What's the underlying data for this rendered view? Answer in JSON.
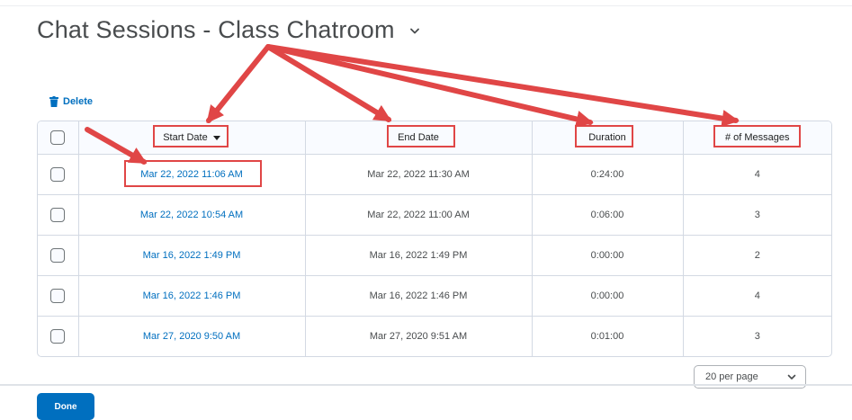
{
  "page": {
    "title": "Chat Sessions - Class Chatroom"
  },
  "toolbar": {
    "delete_label": "Delete"
  },
  "table": {
    "columns": {
      "start_date": "Start Date",
      "end_date": "End Date",
      "duration": "Duration",
      "messages": "# of Messages"
    },
    "sort": {
      "column": "start_date",
      "direction": "descending"
    },
    "rows": [
      {
        "start": "Mar 22, 2022 11:06 AM",
        "end": "Mar 22, 2022 11:30 AM",
        "duration": "0:24:00",
        "messages": "4"
      },
      {
        "start": "Mar 22, 2022 10:54 AM",
        "end": "Mar 22, 2022 11:00 AM",
        "duration": "0:06:00",
        "messages": "3"
      },
      {
        "start": "Mar 16, 2022 1:49 PM",
        "end": "Mar 16, 2022 1:49 PM",
        "duration": "0:00:00",
        "messages": "2"
      },
      {
        "start": "Mar 16, 2022 1:46 PM",
        "end": "Mar 16, 2022 1:46 PM",
        "duration": "0:00:00",
        "messages": "4"
      },
      {
        "start": "Mar 27, 2020 9:50 AM",
        "end": "Mar 27, 2020 9:51 AM",
        "duration": "0:01:00",
        "messages": "3"
      }
    ]
  },
  "pagination": {
    "per_page_value": "20 per page"
  },
  "footer": {
    "done_label": "Done"
  },
  "colors": {
    "link": "#006fbf",
    "primary_button": "#006fbf",
    "annotation": "#e04646",
    "title": "#494c4e"
  },
  "icons": {
    "title_menu": "chevron-down-icon",
    "delete": "trash-icon",
    "sort": "caret-down-icon",
    "per_page": "chevron-down-icon"
  }
}
